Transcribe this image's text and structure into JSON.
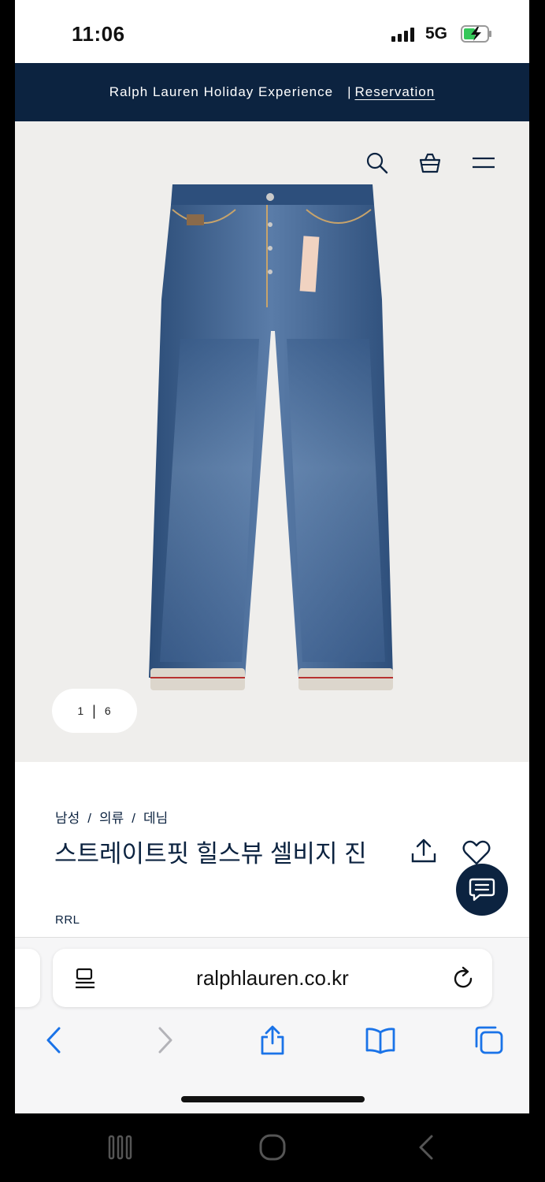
{
  "status_bar": {
    "time": "11:06",
    "network": "5G"
  },
  "promo": {
    "text": "Ralph Lauren Holiday Experience",
    "separator": "|",
    "link": "Reservation"
  },
  "header": {
    "icons": [
      "search-icon",
      "shopping-bag-icon",
      "menu-icon"
    ]
  },
  "gallery": {
    "current": "1",
    "divider": "|",
    "total": "6"
  },
  "product": {
    "breadcrumbs": [
      "남성",
      "의류",
      "데님"
    ],
    "crumb_sep": "/",
    "title": "스트레이트핏 힐스뷰 셀비지 진",
    "brand": "RRL"
  },
  "browser": {
    "url": "ralphlauren.co.kr",
    "toolbar": [
      "back-icon",
      "forward-icon",
      "share-icon",
      "bookmarks-icon",
      "tabs-icon"
    ]
  },
  "colors": {
    "navy": "#0c2340",
    "accent_blue": "#1a73e8",
    "denim": "#3b5f8c"
  }
}
